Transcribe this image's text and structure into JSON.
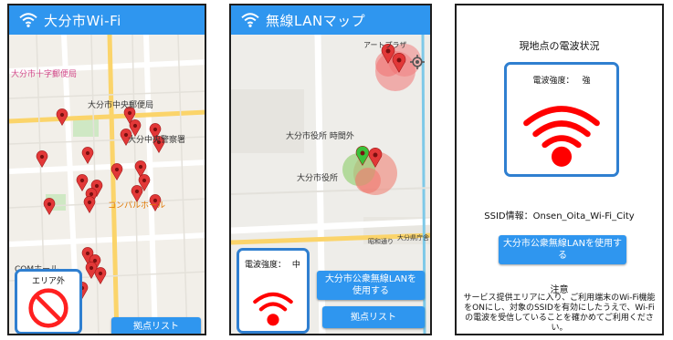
{
  "screen1": {
    "title": "大分市Wi-Fi",
    "status_label": "エリア外",
    "list_button": "拠点リスト",
    "map_labels": [
      "大分市中央郵便局",
      "コンパルホール",
      "大分中央警察署",
      "大分市十字郵便局",
      "COMホール"
    ]
  },
  "screen2": {
    "title": "無線LANマップ",
    "signal_label": "電波強度：",
    "signal_value": "中",
    "use_button": "大分市公衆無線LANを使用する",
    "list_button": "拠点リスト",
    "map_labels": [
      "大分市役所 時間外",
      "大分市役所",
      "昭和通り",
      "大分県庁舎",
      "アートプラザ"
    ]
  },
  "screen3": {
    "heading": "現地点の電波状況",
    "signal_label": "電波強度：",
    "signal_value": "強",
    "ssid": "SSID情報：Onsen_Oita_Wi-Fi_City",
    "use_button": "大分市公衆無線LANを使用する",
    "notice_title": "注意",
    "notice_body": "サービス提供エリアに入り、ご利用端末のWi-Fi機能をONにし、対象のSSIDを有効にしたうえで、Wi-Fiの電波を受信していることを確かめてご利用ください。"
  },
  "colors": {
    "accent": "#2f96ef",
    "pin": "#e23838",
    "signal": "#ff0000",
    "panel_border": "#2f7fd0"
  },
  "icons": [
    "wifi-icon",
    "map-pin-icon",
    "no-entry-icon",
    "wifi-signal-icon",
    "location-target-icon"
  ]
}
